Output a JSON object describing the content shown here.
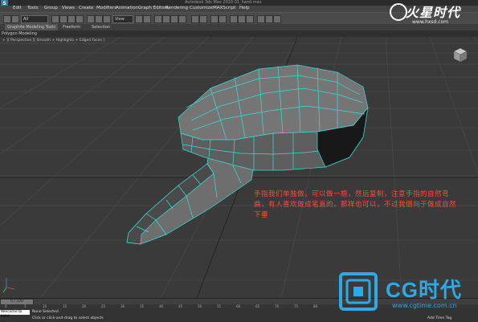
{
  "title_bar": {
    "text": "Autodesk 3ds Max 2010    01_hand.max"
  },
  "menu": [
    "Edit",
    "Tools",
    "Group",
    "Views",
    "Create",
    "Modifiers",
    "Animation",
    "Graph Editors",
    "Rendering",
    "Customize",
    "MAXScript",
    "Help"
  ],
  "toolbar": {
    "selection_filter": "All",
    "view_dropdown": "View"
  },
  "ribbon": {
    "tabs": [
      "Graphite Modeling Tools",
      "Freeform",
      "Selection"
    ]
  },
  "panel": {
    "label": "Polygon Modeling"
  },
  "viewport": {
    "label": "+ ][ Perspective ][ Smooth + Highlights + Edged Faces ]",
    "caption": "手指我们单独做，可以做一根，然后复制，注意手指的自然弯曲，有人喜欢做成笔直的，那样也可以，不过我個向于做成自然下垂",
    "mesh_edge_color": "#35e0d4"
  },
  "watermark_top": {
    "brand": "火星时代",
    "url": "www.hxsd.com"
  },
  "watermark_bottom": {
    "brand": "CG时代",
    "url": "www.cgtime.com.cn"
  },
  "timeline": {
    "frame_label": "0 / 100",
    "ticks": [
      "0",
      "5",
      "10",
      "15",
      "20",
      "25",
      "30",
      "35",
      "40",
      "45",
      "50",
      "55",
      "60",
      "65",
      "70",
      "75",
      "80"
    ]
  },
  "status": {
    "maxscript": "Welcome to MAX!",
    "line1": "None Selected",
    "line2": "Click or click-and-drag to select objects",
    "add_time_tag": "Add Time Tag"
  }
}
